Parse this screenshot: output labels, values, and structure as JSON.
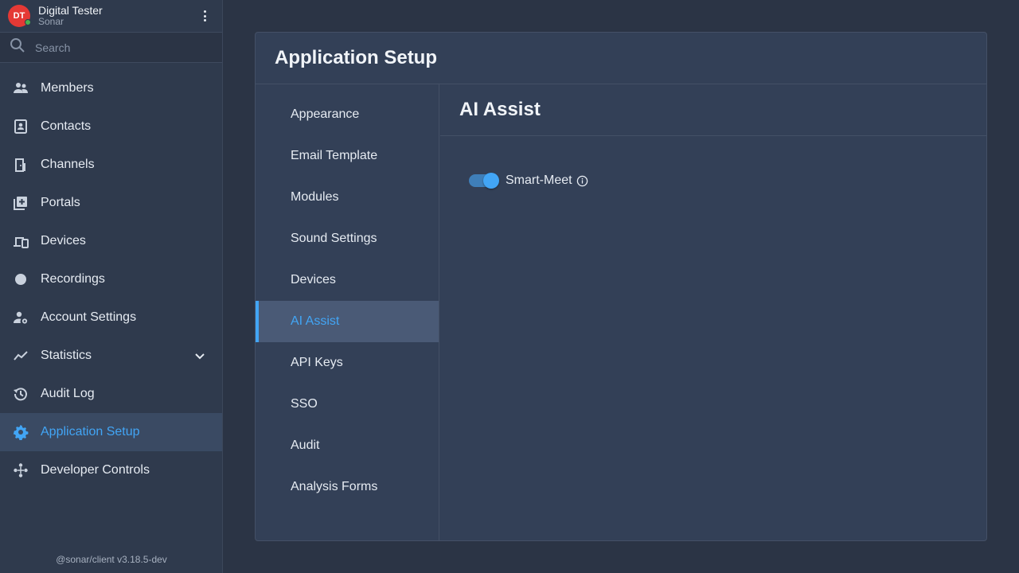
{
  "user": {
    "initials": "DT",
    "name": "Digital Tester",
    "org": "Sonar"
  },
  "search": {
    "placeholder": "Search"
  },
  "sidebar": {
    "items": [
      {
        "label": "Members",
        "icon": "members-icon"
      },
      {
        "label": "Contacts",
        "icon": "contacts-icon"
      },
      {
        "label": "Channels",
        "icon": "channels-icon"
      },
      {
        "label": "Portals",
        "icon": "portals-icon"
      },
      {
        "label": "Devices",
        "icon": "devices-icon"
      },
      {
        "label": "Recordings",
        "icon": "recordings-icon"
      },
      {
        "label": "Account Settings",
        "icon": "account-settings-icon"
      },
      {
        "label": "Statistics",
        "icon": "statistics-icon"
      },
      {
        "label": "Audit Log",
        "icon": "audit-log-icon"
      },
      {
        "label": "Application Setup",
        "icon": "gear-icon"
      },
      {
        "label": "Developer Controls",
        "icon": "developer-controls-icon"
      }
    ],
    "active_index": 9
  },
  "version": "@sonar/client v3.18.5-dev",
  "page": {
    "title": "Application Setup",
    "subnav": [
      "Appearance",
      "Email Template",
      "Modules",
      "Sound Settings",
      "Devices",
      "AI Assist",
      "API Keys",
      "SSO",
      "Audit",
      "Analysis Forms"
    ],
    "active_subnav": 5,
    "section_title": "AI Assist",
    "toggle": {
      "label": "Smart-Meet",
      "enabled": true
    }
  },
  "colors": {
    "accent": "#42a5f5",
    "avatar": "#e53935",
    "presence": "#4caf50",
    "background": "#2b3445",
    "sidebar": "#2f3a4d",
    "card": "#334057"
  }
}
